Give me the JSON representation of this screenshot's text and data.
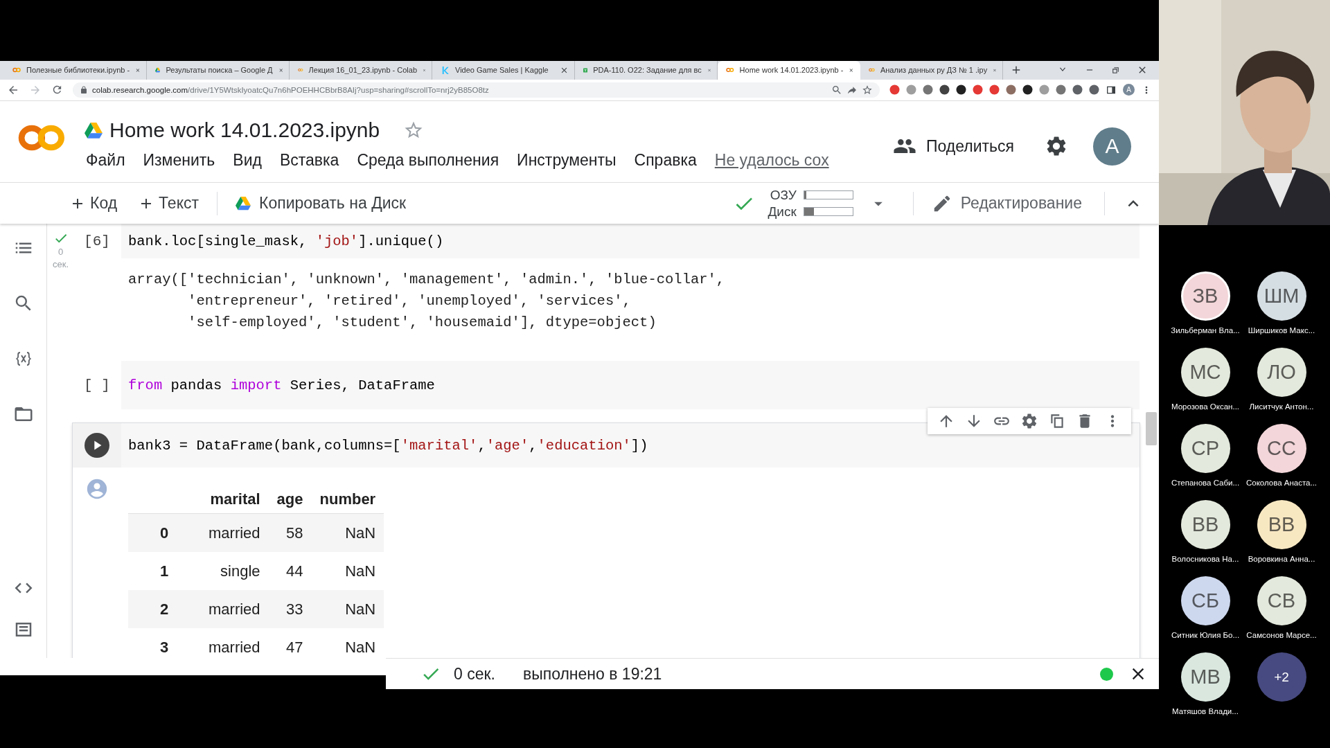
{
  "tabs": [
    {
      "title": "Полезные библиотеки.ipynb -",
      "kind": "colab",
      "selected": false
    },
    {
      "title": "Результаты поиска – Google Д",
      "kind": "drive",
      "selected": false
    },
    {
      "title": "Лекция 16_01_23.ipynb - Colab",
      "kind": "colab",
      "selected": false
    },
    {
      "title": "Video Game Sales | Kaggle",
      "kind": "kaggle",
      "selected": false
    },
    {
      "title": "PDA-110. O22: Задание для вс",
      "kind": "sheet",
      "selected": false
    },
    {
      "title": "Home work 14.01.2023.ipynb - ",
      "kind": "colab",
      "selected": true
    },
    {
      "title": "Анализ данных ру ДЗ № 1 .ipy",
      "kind": "colab",
      "selected": false
    }
  ],
  "address": {
    "domain": "colab.research.google.com",
    "path": "/drive/1Y5WtskIyoatcQu7n6hPOEHHCBbrB8AIj?usp=sharing#scrollTo=nrj2yB85O8tz"
  },
  "browser_profile": "A",
  "notebook": {
    "title": "Home work 14.01.2023.ipynb",
    "menu": [
      "Файл",
      "Изменить",
      "Вид",
      "Вставка",
      "Среда выполнения",
      "Инструменты",
      "Справка"
    ],
    "save_status": "Не удалось сох",
    "share": "Поделиться",
    "avatar": "A"
  },
  "toolbar": {
    "add_code": "Код",
    "add_text": "Текст",
    "copy_to_drive": "Копировать на Диск",
    "resources": [
      {
        "label": "ОЗУ",
        "level": 0.05
      },
      {
        "label": "Диск",
        "level": 0.2
      }
    ],
    "mode": "Редактирование"
  },
  "cells": [
    {
      "exec_label": "[6]",
      "kind": "executed",
      "time_value": "0",
      "time_unit": "сек.",
      "focused": false,
      "code": [
        {
          "text": "bank.loc[single_mask, ",
          "kind": "plain"
        },
        {
          "text": "'job'",
          "kind": "string"
        },
        {
          "text": "].unique()",
          "kind": "plain"
        }
      ],
      "output": {
        "kind": "text",
        "lines": [
          "array(['technician', 'unknown', 'management', 'admin.', 'blue-collar',",
          "       'entrepreneur', 'retired', 'unemployed', 'services',",
          "       'self-employed', 'student', 'housemaid'], dtype=object)"
        ]
      }
    },
    {
      "exec_label": "[ ]",
      "focused": false,
      "code": [
        {
          "text": "from",
          "kind": "keyword"
        },
        {
          "text": " pandas ",
          "kind": "plain"
        },
        {
          "text": "import",
          "kind": "keyword"
        },
        {
          "text": " Series, DataFrame",
          "kind": "plain"
        }
      ]
    },
    {
      "focused": true,
      "code": [
        {
          "text": "bank3 = DataFrame(bank,columns=[",
          "kind": "plain"
        },
        {
          "text": "'marital'",
          "kind": "string"
        },
        {
          "text": ",",
          "kind": "plain"
        },
        {
          "text": "'age'",
          "kind": "string"
        },
        {
          "text": ",",
          "kind": "plain"
        },
        {
          "text": "'education'",
          "kind": "string"
        },
        {
          "text": "])",
          "kind": "plain"
        }
      ],
      "output": {
        "kind": "table",
        "columns": [
          "marital",
          "age",
          "number"
        ],
        "rows": [
          {
            "index": "0",
            "values": [
              "married",
              "58",
              "NaN"
            ]
          },
          {
            "index": "1",
            "values": [
              "single",
              "44",
              "NaN"
            ]
          },
          {
            "index": "2",
            "values": [
              "married",
              "33",
              "NaN"
            ]
          },
          {
            "index": "3",
            "values": [
              "married",
              "47",
              "NaN"
            ]
          }
        ]
      }
    }
  ],
  "status_bar": {
    "time": "0 сек.",
    "message": "выполнено в 19:21"
  },
  "participants": [
    {
      "initials": "ЗВ",
      "name": "Зильберман Вла...",
      "color": "#f3d6d9",
      "speaking": true,
      "kind": "person"
    },
    {
      "initials": "ШМ",
      "name": "Ширшиков Макс...",
      "color": "#d5dee3",
      "speaking": false,
      "kind": "person"
    },
    {
      "initials": "МС",
      "name": "Морозова Оксан...",
      "color": "#e3e9dc",
      "speaking": false,
      "kind": "person"
    },
    {
      "initials": "ЛО",
      "name": "Лиситчук Антон...",
      "color": "#e3e9dc",
      "speaking": false,
      "kind": "person"
    },
    {
      "initials": "СР",
      "name": "Степанова Саби...",
      "color": "#e3e9dc",
      "speaking": false,
      "kind": "person"
    },
    {
      "initials": "СС",
      "name": "Соколова Анаста...",
      "color": "#f3d6d9",
      "speaking": false,
      "kind": "person"
    },
    {
      "initials": "ВВ",
      "name": "Волосникова На...",
      "color": "#e3e9dc",
      "speaking": false,
      "kind": "person"
    },
    {
      "initials": "ВВ",
      "name": "Воровкина Анна...",
      "color": "#f8e8c2",
      "speaking": false,
      "kind": "person"
    },
    {
      "initials": "СБ",
      "name": "Ситник Юлия Бо...",
      "color": "#cdd8ee",
      "speaking": false,
      "kind": "person"
    },
    {
      "initials": "СВ",
      "name": "Самсонов Марсе...",
      "color": "#e3e9dc",
      "speaking": false,
      "kind": "person"
    },
    {
      "initials": "МВ",
      "name": "Матяшов Влади...",
      "color": "#d9e7df",
      "speaking": false,
      "kind": "person"
    },
    {
      "initials": "+2",
      "color": "#474a80",
      "speaking": false,
      "kind": "more"
    }
  ]
}
